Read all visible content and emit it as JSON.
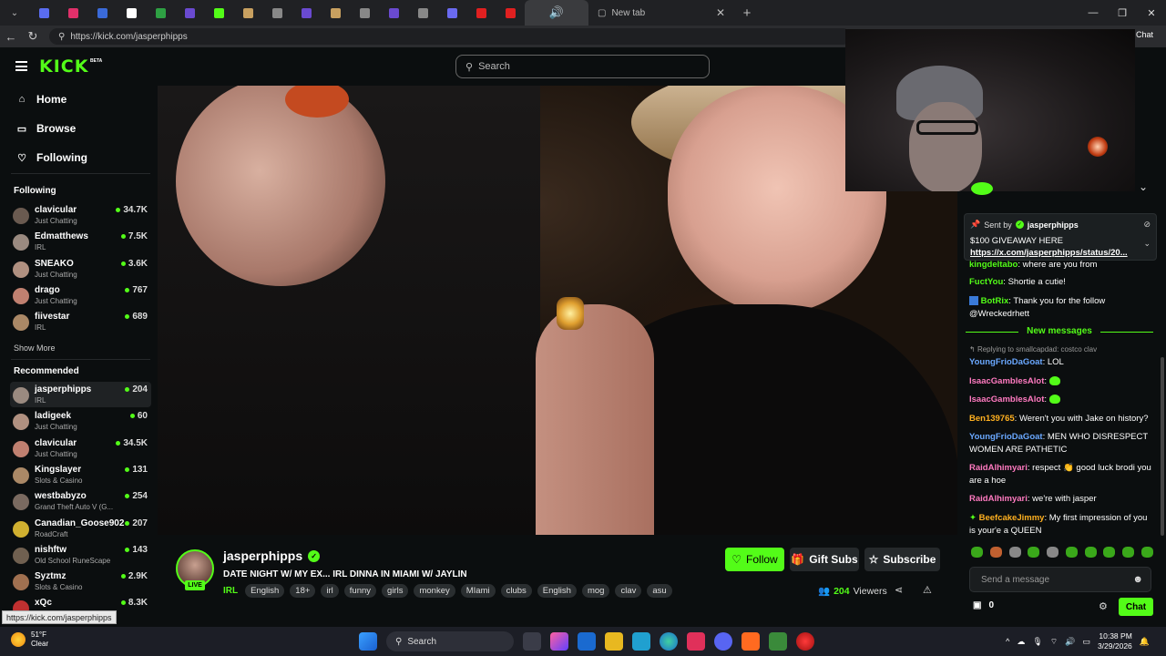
{
  "browser": {
    "tabs_favicon_colors": [
      "#5a6cf0",
      "#e0306a",
      "#3a6ad8",
      "#ffffff",
      "#2ea043",
      "#6a4ad0",
      "#53fc18",
      "#c8a060",
      "#888888",
      "#6a4ad0",
      "#c8a060",
      "#888888",
      "#6a4ad0",
      "#888888",
      "#6a6af0",
      "#e02020",
      "#e02020"
    ],
    "new_tab_label": "New tab",
    "url": "https://kick.com/jasperphipps",
    "chat_tab_label": "Chat"
  },
  "header": {
    "logo": "KICK",
    "beta": "BETA",
    "search_placeholder": "Search"
  },
  "sidebar": {
    "nav": [
      {
        "label": "Home",
        "icon": "home-icon"
      },
      {
        "label": "Browse",
        "icon": "browse-icon"
      },
      {
        "label": "Following",
        "icon": "heart-icon"
      }
    ],
    "following_title": "Following",
    "following": [
      {
        "name": "clavicular",
        "category": "Just Chatting",
        "viewers": "34.7K"
      },
      {
        "name": "Edmatthews",
        "category": "IRL",
        "viewers": "7.5K"
      },
      {
        "name": "SNEAKO",
        "category": "Just Chatting",
        "viewers": "3.6K"
      },
      {
        "name": "drago",
        "category": "Just Chatting",
        "viewers": "767"
      },
      {
        "name": "fiivestar",
        "category": "IRL",
        "viewers": "689"
      }
    ],
    "show_more": "Show More",
    "recommended_title": "Recommended",
    "recommended": [
      {
        "name": "jasperphipps",
        "category": "IRL",
        "viewers": "204"
      },
      {
        "name": "ladigeek",
        "category": "Just Chatting",
        "viewers": "60"
      },
      {
        "name": "clavicular",
        "category": "Just Chatting",
        "viewers": "34.5K"
      },
      {
        "name": "Kingslayer",
        "category": "Slots & Casino",
        "viewers": "131"
      },
      {
        "name": "westbabyzo",
        "category": "Grand Theft Auto V (G...",
        "viewers": "254"
      },
      {
        "name": "Canadian_Goose902",
        "category": "RoadCraft",
        "viewers": "207"
      },
      {
        "name": "nishftw",
        "category": "Old School RuneScape",
        "viewers": "143"
      },
      {
        "name": "Syztmz",
        "category": "Slots & Casino",
        "viewers": "2.9K"
      },
      {
        "name": "xQc",
        "category": "",
        "viewers": "8.3K"
      }
    ]
  },
  "stream": {
    "streamer": "jasperphipps",
    "live": "LIVE",
    "title": "DATE NIGHT W/ MY EX... IRL DINNA IN MIAMI W/ JAYLIN",
    "category": "IRL",
    "tags": [
      "English",
      "18+",
      "irl",
      "funny",
      "girls",
      "monkey",
      "MIami",
      "clubs",
      "English",
      "mog",
      "clav",
      "asu"
    ],
    "follow": "Follow",
    "gift_subs": "Gift Subs",
    "subscribe": "Subscribe",
    "viewers_count": "204",
    "viewers_label": "Viewers"
  },
  "chat": {
    "pinned": {
      "sent_by": "Sent by",
      "user": "jasperphipps",
      "line1": "$100 GIVEAWAY HERE",
      "line2": "https://x.com/jasperphipps/status/20..."
    },
    "messages_before": [
      {
        "user": "kingdeltabo",
        "color": "#53fc18",
        "text": "where are you from"
      },
      {
        "user": "FuctYou",
        "color": "#53fc18",
        "text": "Shortie a cutie!"
      },
      {
        "user": "BotRix",
        "color": "#53fc18",
        "text": "Thank you for the follow @Wreckedrhett"
      }
    ],
    "new_messages": "New messages",
    "reply_to": "Replying to smallcapdad: costco clav",
    "messages_after": [
      {
        "user": "YoungFrioDaGoat",
        "color": "#6aa8ff",
        "text": "LOL"
      },
      {
        "user": "IsaacGamblesAlot",
        "color": "#ff7ac0",
        "text": ""
      },
      {
        "user": "IsaacGamblesAlot",
        "color": "#ff7ac0",
        "text": ""
      },
      {
        "user": "Ben139765",
        "color": "#ffb020",
        "text": "Weren't you with Jake on history?"
      },
      {
        "user": "YoungFrioDaGoat",
        "color": "#6aa8ff",
        "text": "MEN WHO DISRESPECT WOMEN ARE PATHETIC"
      },
      {
        "user": "RaidAlhimyari",
        "color": "#ff7ac0",
        "text": "respect 👏 good luck brodi you are a hoe"
      },
      {
        "user": "RaidAlhimyari",
        "color": "#ff7ac0",
        "text": "we're with jasper"
      },
      {
        "user": "BeefcakeJimmy",
        "color": "#ffb020",
        "text": "My first impression of you is your'e a QUEEN"
      }
    ],
    "input_placeholder": "Send a message",
    "points": "0",
    "send": "Chat"
  },
  "status_url": "https://kick.com/jasperphipps",
  "taskbar": {
    "temp": "51°F",
    "condition": "Clear",
    "search": "Search",
    "time": "10:38 PM",
    "date": "3/29/2026"
  },
  "colors": {
    "accent": "#53fc18",
    "background": "#0b0e0f"
  }
}
